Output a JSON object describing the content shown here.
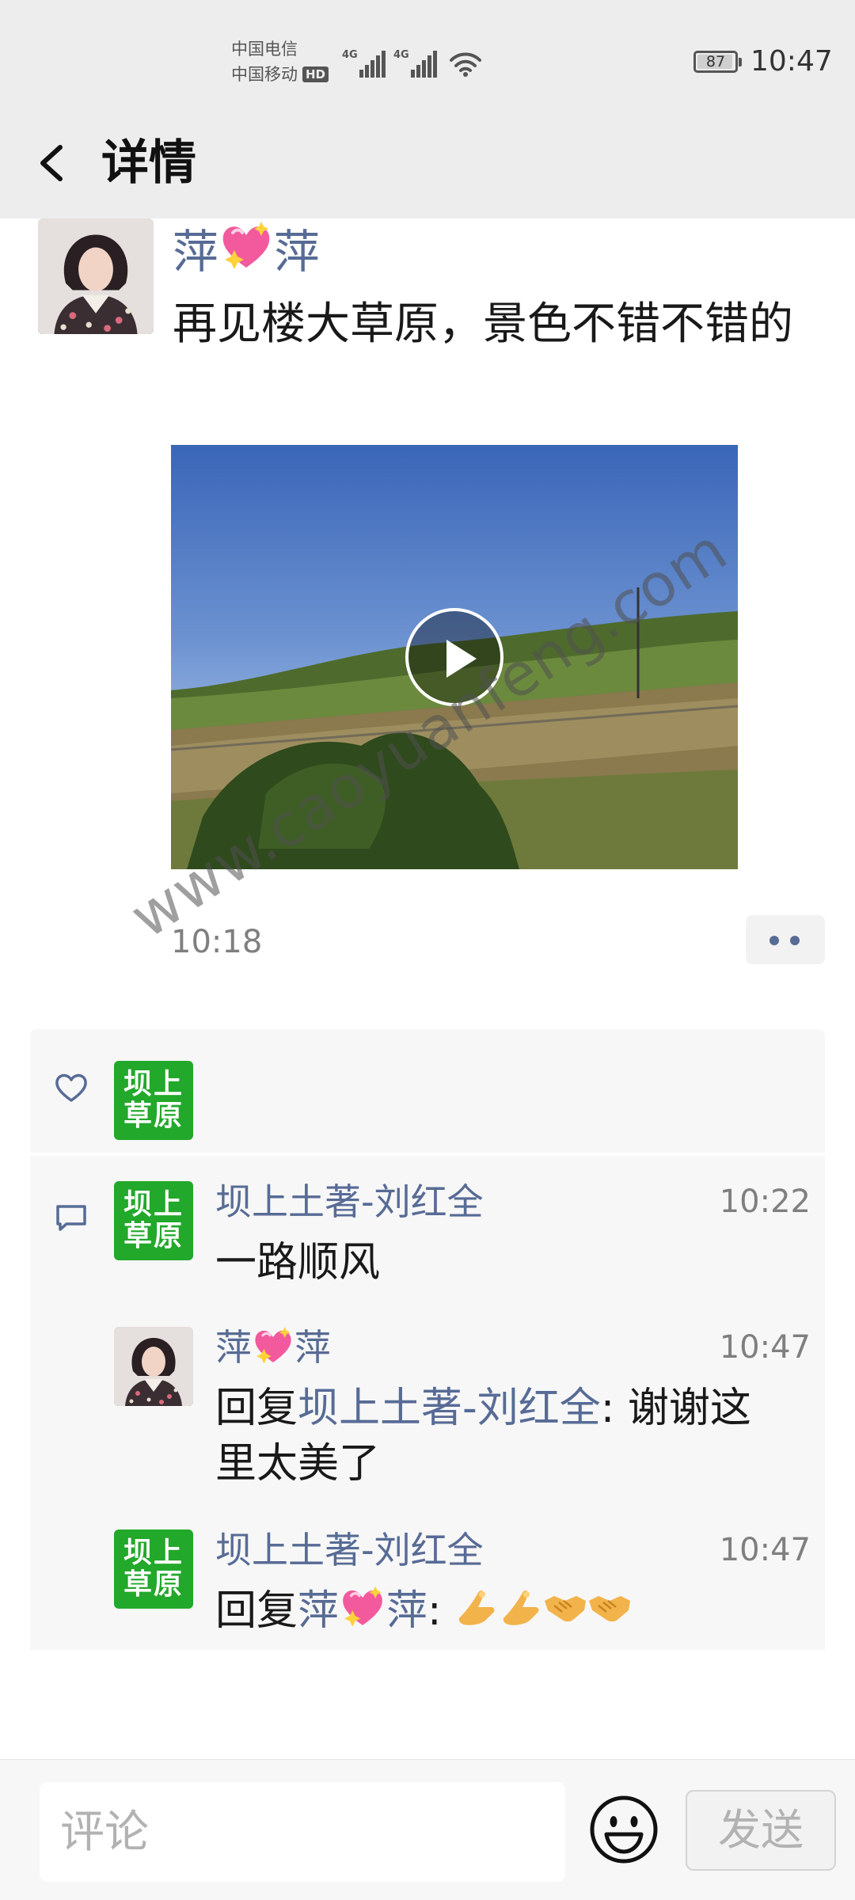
{
  "status_bar": {
    "carrier_1": "中国电信",
    "carrier_2": "中国移动",
    "hd": "HD",
    "network_1": "4G",
    "network_2": "4G",
    "battery": "87",
    "time": "10:47"
  },
  "nav": {
    "title": "详情"
  },
  "post": {
    "author_name_part1": "萍",
    "author_name_part2": "萍",
    "text": "再见楼大草原，景色不错不错的",
    "time": "10:18"
  },
  "likes": {
    "avatar_line_1": "坝上",
    "avatar_line_2": "草原"
  },
  "comments": [
    {
      "name": "坝上土著-刘红全",
      "time": "10:22",
      "text": "一路顺风",
      "avatar_line_1": "坝上",
      "avatar_line_2": "草原"
    },
    {
      "name_part1": "萍",
      "name_part2": "萍",
      "time": "10:47",
      "reply_prefix": "回复",
      "reply_to": "坝上土著-刘红全",
      "text": ": 谢谢这里太美了"
    },
    {
      "name": "坝上土著-刘红全",
      "time": "10:47",
      "reply_prefix": "回复",
      "reply_to_part1": "萍",
      "reply_to_part2": "萍",
      "text_sep": ": ",
      "avatar_line_1": "坝上",
      "avatar_line_2": "草原"
    }
  ],
  "bottom_bar": {
    "input_placeholder": "评论",
    "send_label": "发送"
  },
  "watermark": "www.caoyuanfeng.com",
  "colors": {
    "link_blue": "#576b95",
    "logo_green": "#22a82a",
    "bar_gray": "#ededed"
  }
}
